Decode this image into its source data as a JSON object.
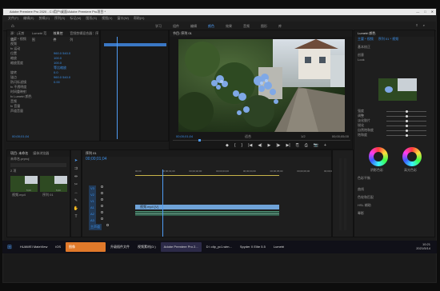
{
  "window": {
    "title": "Adobe Premiere Pro 2020 - C:\\用户\\桌面\\Adobe Premiere Pro项目 *"
  },
  "menubar": [
    "文件(F)",
    "编辑(E)",
    "剪辑(C)",
    "序列(S)",
    "标记(M)",
    "图形(G)",
    "视图(V)",
    "窗口(W)",
    "帮助(H)"
  ],
  "workspace_tabs": [
    "学习",
    "组件",
    "编辑",
    "颜色",
    "效果",
    "音频",
    "图形",
    "库"
  ],
  "workspace_active_index": 3,
  "effect_controls": {
    "tabs": [
      "源：(无剪辑)",
      "Lumetri 范围",
      "效果控件",
      "音频剪辑混合器：序列"
    ],
    "active_tab_index": 2,
    "rows": [
      {
        "label": "主要 * 视频",
        "value": ""
      },
      {
        "label": "视频",
        "value": ""
      },
      {
        "label": "fx 运动",
        "value": ""
      },
      {
        "label": "位置",
        "value": "960.0   540.0"
      },
      {
        "label": "缩放",
        "value": "100.0"
      },
      {
        "label": "缩放宽度",
        "value": "100.0"
      },
      {
        "label": "",
        "value": "等比缩放"
      },
      {
        "label": "旋转",
        "value": "0.0"
      },
      {
        "label": "锚点",
        "value": "960.0   540.0"
      },
      {
        "label": "防闪烁滤镜",
        "value": "0.00"
      },
      {
        "label": "fx 不透明度",
        "value": ""
      },
      {
        "label": "时间重映射",
        "value": ""
      },
      {
        "label": "fx Lumetri 颜色",
        "value": ""
      },
      {
        "label": "音频",
        "value": ""
      },
      {
        "label": "fx 音量",
        "value": ""
      },
      {
        "label": "声道音量",
        "value": ""
      }
    ],
    "timecode": "00;00;01;04"
  },
  "program_monitor": {
    "tab": "节目: 序列 01",
    "timecode_left": "00;00;01;04",
    "fit": "适合",
    "quality": "1/2",
    "timecode_right": "00;00;05;00",
    "controls": [
      "◆",
      "{",
      "}",
      "|◀",
      "◀|",
      "▶",
      "|▶",
      "▶|",
      "⎘",
      "⎙",
      "📷",
      "+"
    ]
  },
  "lumetri": {
    "title": "Lumetri 颜色",
    "tabs": [
      "主要 * 视频",
      "序列 01 * 视频"
    ],
    "sections": [
      "基本校正",
      "创意",
      "Look",
      "曲线",
      "色轮和匹配",
      "HSL 辅助",
      "晕影"
    ],
    "adjust_labels": [
      "强度",
      "调整",
      "淡化胶片",
      "锐化",
      "自然饱和度",
      "饱和度"
    ],
    "wheel_labels": [
      "阴影色彩",
      "高光色彩"
    ],
    "balance_label": "色彩平衡"
  },
  "project_panel": {
    "tabs": [
      "项目: 未命名",
      "媒体浏览器"
    ],
    "file": "未命名.prproj",
    "count": "2 项",
    "thumb_labels": [
      "视频.mp4",
      "序列 01"
    ],
    "thumb_durations": [
      "5;00",
      "5;00"
    ]
  },
  "timeline": {
    "tab": "序列 01",
    "timecode": "00;00;01;04",
    "ruler": [
      "00;00",
      "00;00;01;00",
      "00;00;02;00",
      "00;00;03;00",
      "00;00;04;00",
      "00;00;05;00",
      "00;00;06;00",
      "00;00;07;00"
    ],
    "tracks": [
      "V3",
      "V2",
      "V1",
      "A1",
      "A2",
      "A3",
      "主声道"
    ],
    "clip_video": "视频.mp4 [V]",
    "playhead_fraction": 0.14
  },
  "taskbar": {
    "items": [
      "HUAWEI MateView",
      "iOS",
      "图像",
      "升级插件文件",
      "视频素材(D:)",
      "Adobe Premiere Pro 2...",
      "D:\\ clip_yc1.wim...",
      "Spyder X Elite 5.5",
      "Lumetri"
    ],
    "active_index": 2,
    "time": "10:21",
    "date": "2021/5/14"
  }
}
